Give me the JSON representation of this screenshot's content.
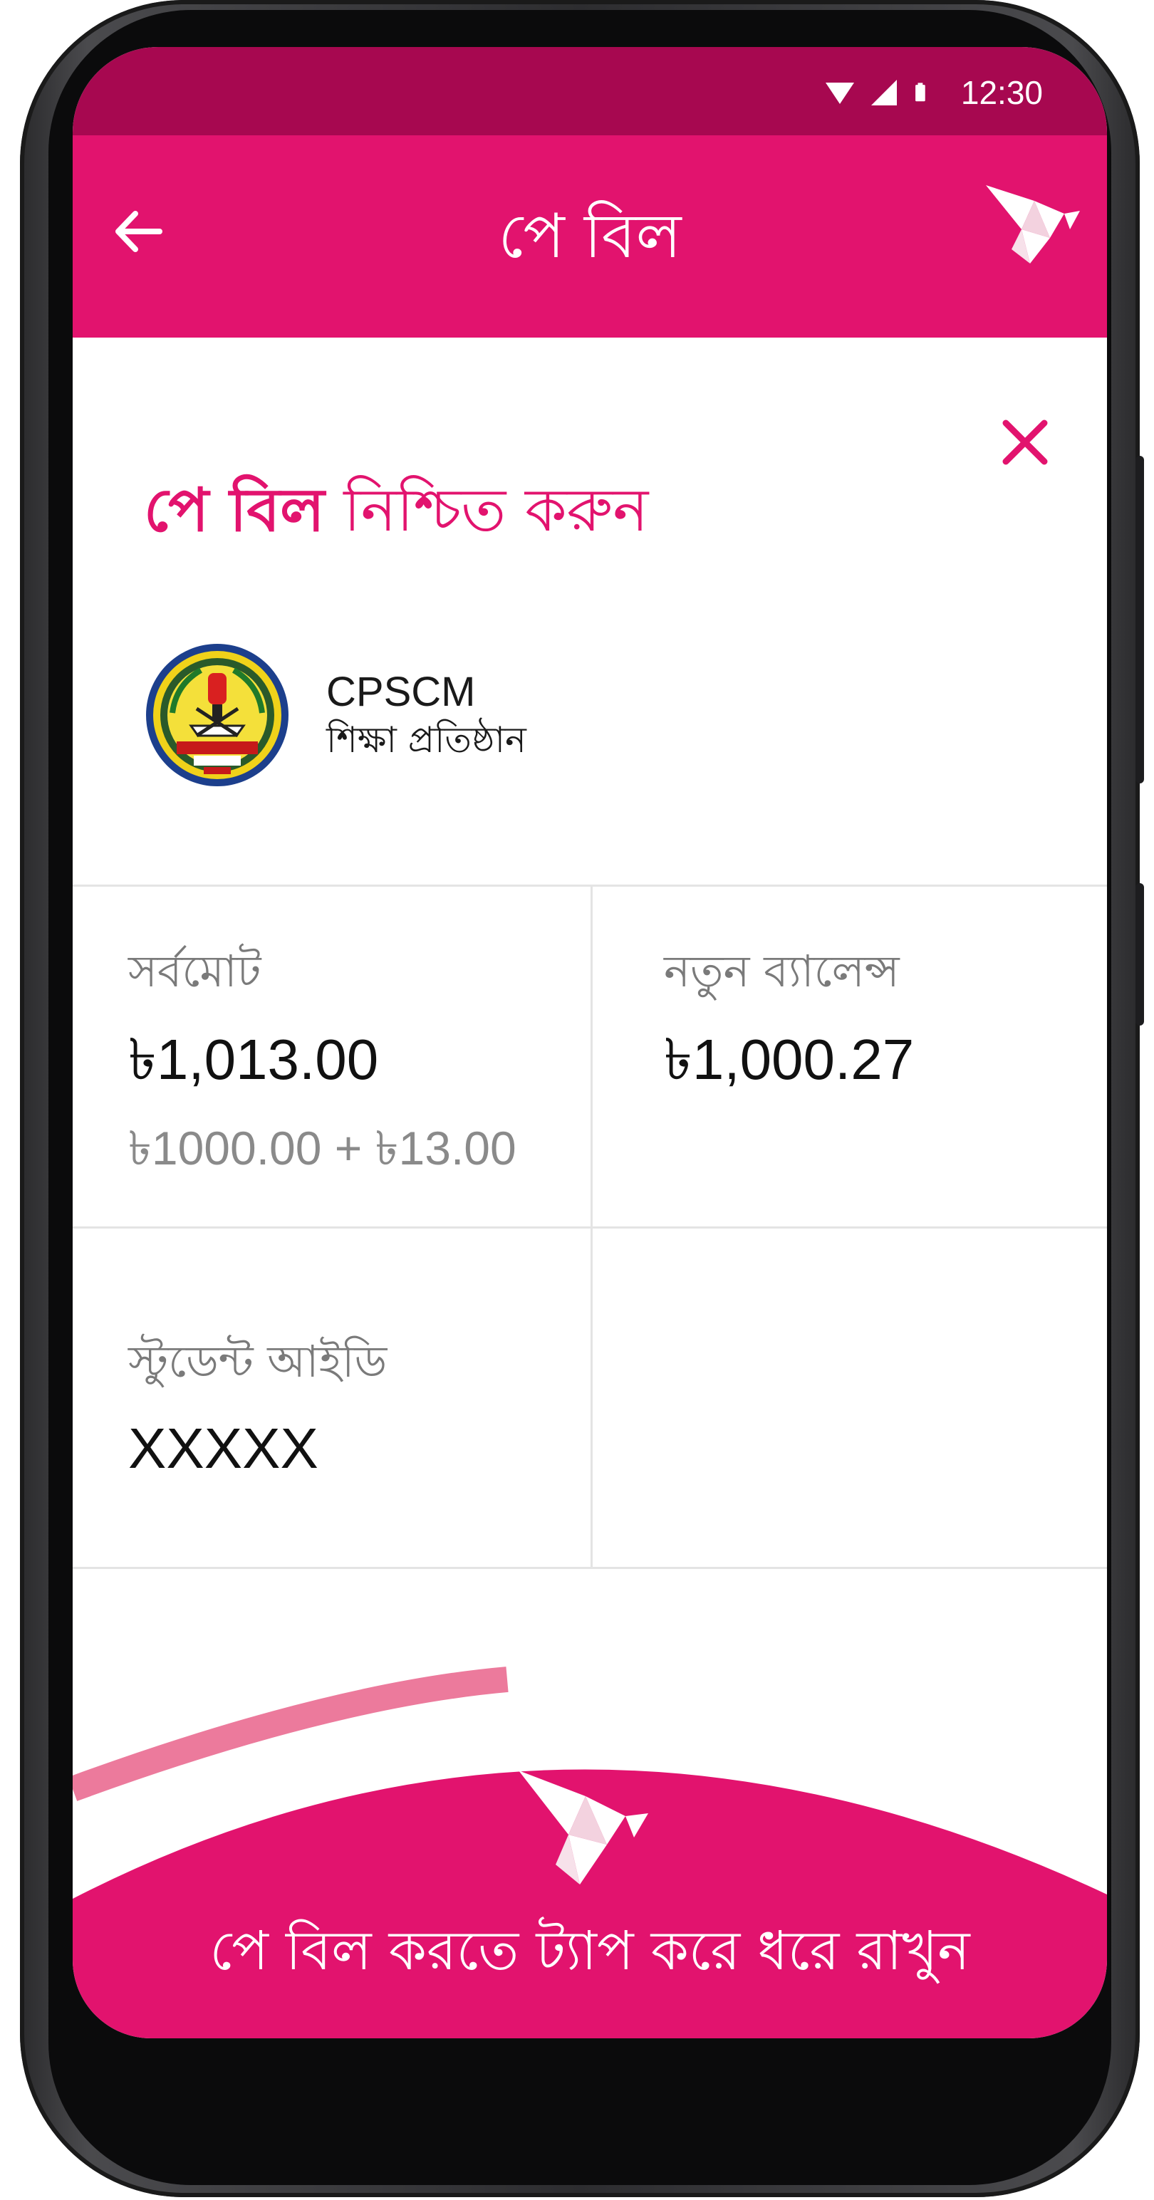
{
  "status_bar": {
    "time": "12:30",
    "icons": [
      "wifi-icon",
      "signal-icon",
      "battery-icon"
    ]
  },
  "header": {
    "title": "পে বিল",
    "back_icon": "arrow-left-icon",
    "brand_icon": "bird-logo-icon"
  },
  "confirm": {
    "title_bold": "পে বিল",
    "title_rest": "নিশ্চিত করুন",
    "close_icon": "close-icon"
  },
  "biller": {
    "name": "CPSCM",
    "type": "শিক্ষা প্রতিষ্ঠান",
    "logo": "institution-seal-logo"
  },
  "summary": {
    "total_label": "সর্বমোট",
    "total_value": "৳1,013.00",
    "total_breakdown": "৳1000.00 + ৳13.00",
    "new_balance_label": "নতুন ব্যালেন্স",
    "new_balance_value": "৳1,000.27",
    "student_id_label": "স্টুডেন্ট আইডি",
    "student_id_value": "XXXXX"
  },
  "action": {
    "tap_hint": "পে বিল করতে ট্যাপ করে ধরে রাখুন",
    "icon": "bird-logo-icon"
  },
  "colors": {
    "brand_pink": "#e2136e",
    "status_bar": "#a70850",
    "arc_light": "#ec7a9c"
  }
}
